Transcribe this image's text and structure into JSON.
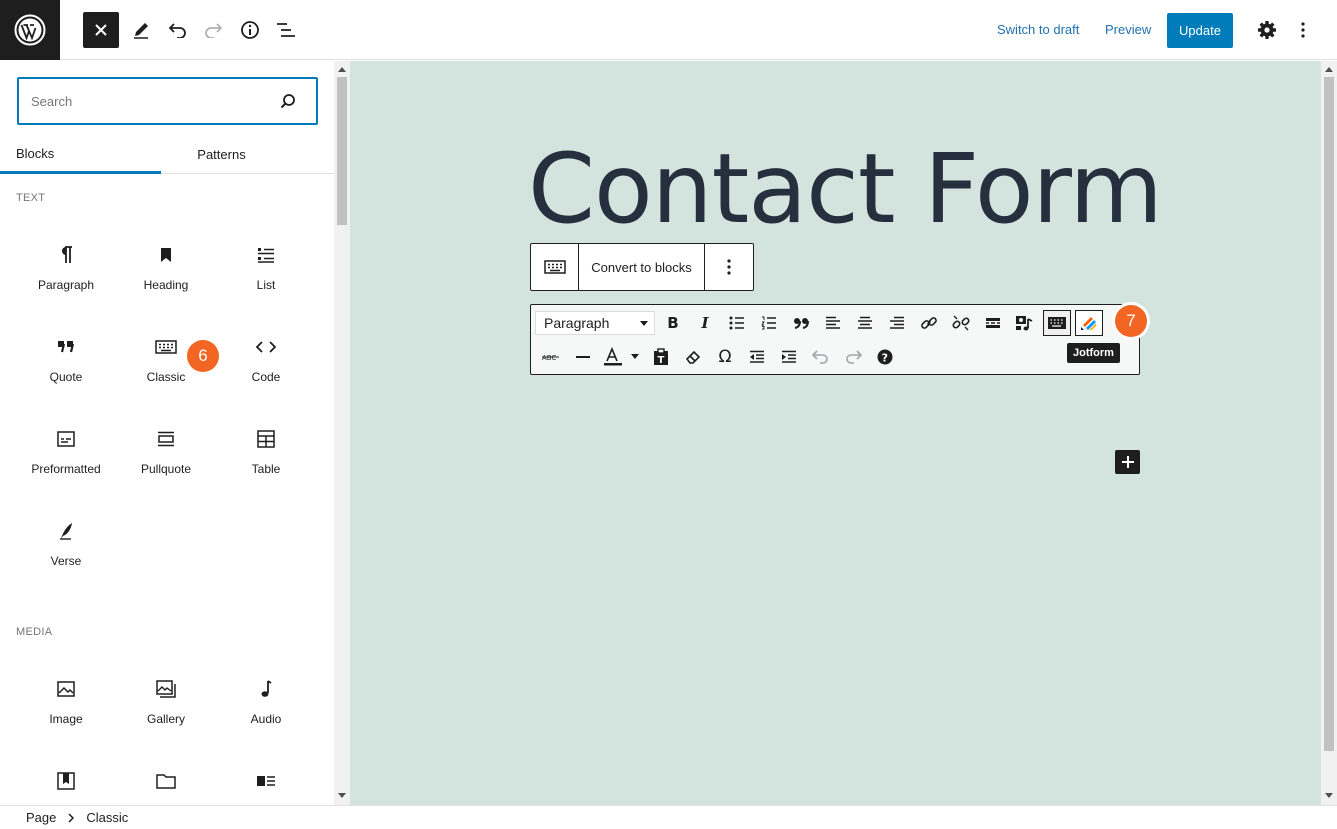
{
  "topbar": {
    "close_icon": "close-icon",
    "tools": [
      "pencil-icon",
      "undo-icon",
      "redo-icon",
      "info-icon",
      "list-view-icon"
    ],
    "switch_to_draft": "Switch to draft",
    "preview": "Preview",
    "update": "Update"
  },
  "inserter": {
    "search_placeholder": "Search",
    "tabs": [
      "Blocks",
      "Patterns"
    ],
    "categories": {
      "text": "TEXT",
      "media": "MEDIA"
    },
    "text_blocks": [
      "Paragraph",
      "Heading",
      "List",
      "Quote",
      "Classic",
      "Code",
      "Preformatted",
      "Pullquote",
      "Table",
      "Verse"
    ],
    "media_blocks": [
      "Image",
      "Gallery",
      "Audio"
    ]
  },
  "annotations": {
    "step6": "6",
    "step7": "7"
  },
  "editor": {
    "title": "Contact Form",
    "block_toolbar": {
      "convert": "Convert to blocks"
    },
    "classic_toolbar": {
      "format_select": "Paragraph",
      "tooltip": "Jotform"
    }
  },
  "breadcrumb": {
    "items": [
      "Page",
      "Classic"
    ]
  },
  "colors": {
    "accent": "#007cba",
    "canvas_bg": "#d3e4de",
    "badge": "#f26522"
  }
}
